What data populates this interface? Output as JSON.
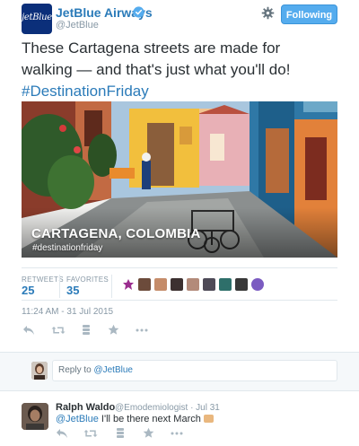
{
  "header": {
    "avatar_text": "jetBlue",
    "name": "JetBlue Airways",
    "handle": "@JetBlue",
    "follow_label": "Following"
  },
  "tweet": {
    "text_line1": "These Cartagena streets are made for",
    "text_line2": "walking — and that's just what you'll do!",
    "hashtag": "#DestinationFriday"
  },
  "media": {
    "caption_title": "CARTAGENA, COLOMBIA",
    "caption_tag": "#destinationfriday"
  },
  "stats": {
    "retweets_label": "RETWEETS",
    "retweets_value": "25",
    "favorites_label": "FAVORITES",
    "favorites_value": "35"
  },
  "timestamp": "11:24 AM - 31 Jul 2015",
  "reply_box": {
    "prefix": "Reply to ",
    "mention": "@JetBlue"
  },
  "reply_tweet": {
    "name": "Ralph Waldo",
    "handle_date": "@Emodemiologist · Jul 31",
    "mention": "@JetBlue",
    "text": " I'll be there next March "
  },
  "colors": {
    "link_blue": "#2b7bb9",
    "follow_bg": "#55acee",
    "muted": "#8899a6"
  },
  "icons": [
    "verified-badge-icon",
    "gear-icon",
    "reply-icon",
    "retweet-icon",
    "stack-icon",
    "star-icon",
    "more-icon"
  ]
}
